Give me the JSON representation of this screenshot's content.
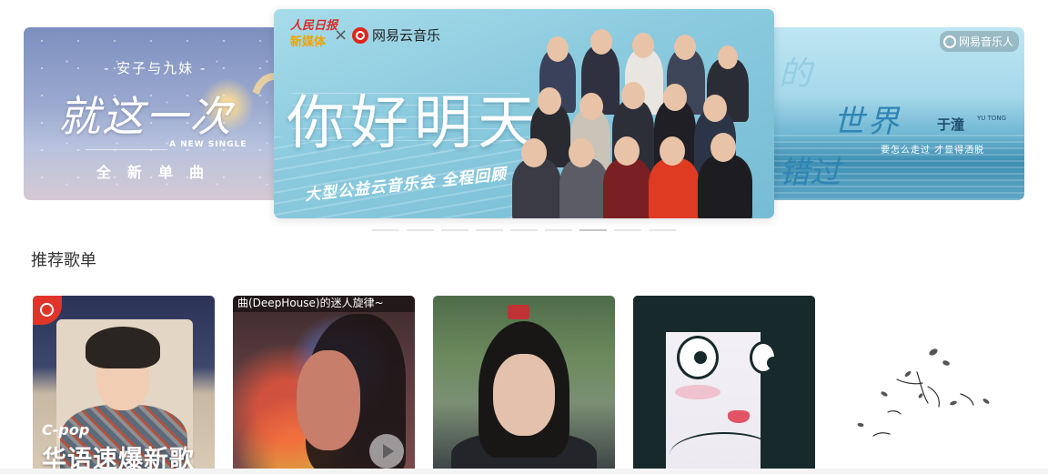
{
  "carousel": {
    "left_banner": {
      "subtitle": "- 安子与九妹 -",
      "title": "就这一次",
      "en_tag": "A NEW SINGLE",
      "cn_tag": "全新单曲"
    },
    "center_banner": {
      "partner_logo_line1": "人民日报",
      "partner_logo_line2": "新媒体",
      "cross": "×",
      "brand": "网易云音乐",
      "title": "你好明天",
      "subtitle": "大型公益云音乐会 全程回顾"
    },
    "right_banner": {
      "brand": "网易音乐人",
      "title_a": "的",
      "title_b": "世界",
      "title_c": "错过",
      "singer": "于潼",
      "singer_en": "YU TONG",
      "lyric": "要怎么走过  才显得洒脱"
    },
    "dot_count": 9,
    "active_dot": 6
  },
  "section": {
    "title": "推荐歌单"
  },
  "playlists": [
    {
      "tag": "C-pop",
      "cover_text": "华语速爆新歌"
    },
    {
      "cover_caption": "曲(DeepHouse)的迷人旋律~"
    },
    {},
    {},
    {}
  ],
  "colors": {
    "netease_red": "#e1352a",
    "people_daily_red": "#d92b2b",
    "accent_yellow": "#f2a400"
  }
}
